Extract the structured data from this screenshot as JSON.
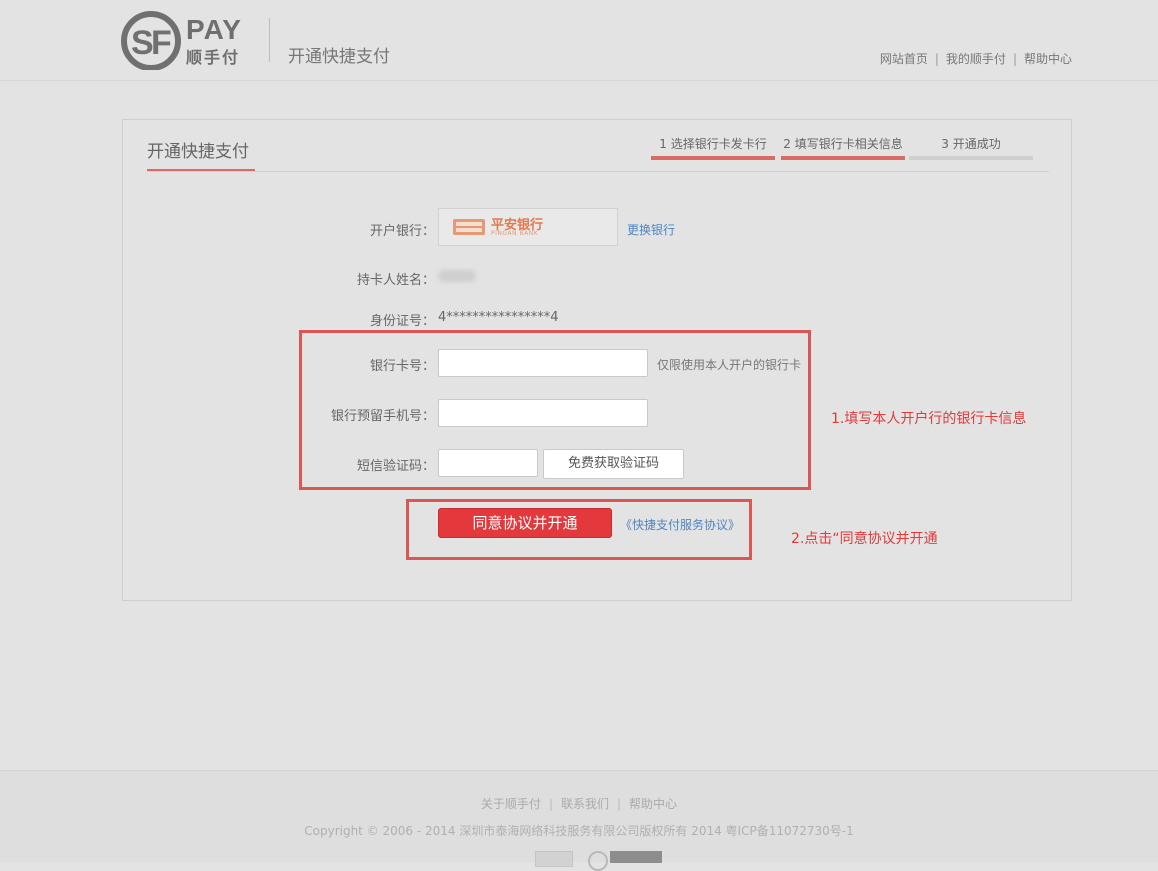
{
  "header": {
    "logo_pay": "PAY",
    "logo_cn": "顺手付",
    "title": "开通快捷支付",
    "nav": [
      "网站首页",
      "我的顺手付",
      "帮助中心"
    ]
  },
  "card": {
    "title": "开通快捷支付",
    "steps": [
      {
        "label": "1 选择银行卡发卡行",
        "status": "done"
      },
      {
        "label": "2 填写银行卡相关信息",
        "status": "done"
      },
      {
        "label": "3 开通成功",
        "status": "todo"
      }
    ]
  },
  "form": {
    "bank_label": "开户银行：",
    "bank_name": "平安银行",
    "bank_name_en": "PINGAN BANK",
    "change_bank": "更换银行",
    "holder_label": "持卡人姓名：",
    "id_label": "身份证号：",
    "id_value": "4****************4",
    "card_label": "银行卡号：",
    "card_value": "",
    "card_hint": "仅限使用本人开户的银行卡",
    "phone_label": "银行预留手机号：",
    "phone_value": "",
    "sms_label": "短信验证码：",
    "sms_value": "",
    "get_code": "免费获取验证码",
    "agree_button": "同意协议并开通",
    "agreement_link": "《快捷支付服务协议》"
  },
  "annotations": {
    "note1": "1.填写本人开户行的银行卡信息",
    "note2": "2.点击“同意协议并开通",
    "color": "#dc5656"
  },
  "footer": {
    "links": [
      "关于顺手付",
      "联系我们",
      "帮助中心"
    ],
    "copyright": "Copyright © 2006 - 2014 深圳市泰海网络科技服务有限公司版权所有 2014 粤ICP备11072730号-1"
  },
  "colors": {
    "accent": "#d96a64",
    "primary_button": "#e3393c",
    "link": "#4f85c0",
    "background": "#e3e3e3"
  }
}
